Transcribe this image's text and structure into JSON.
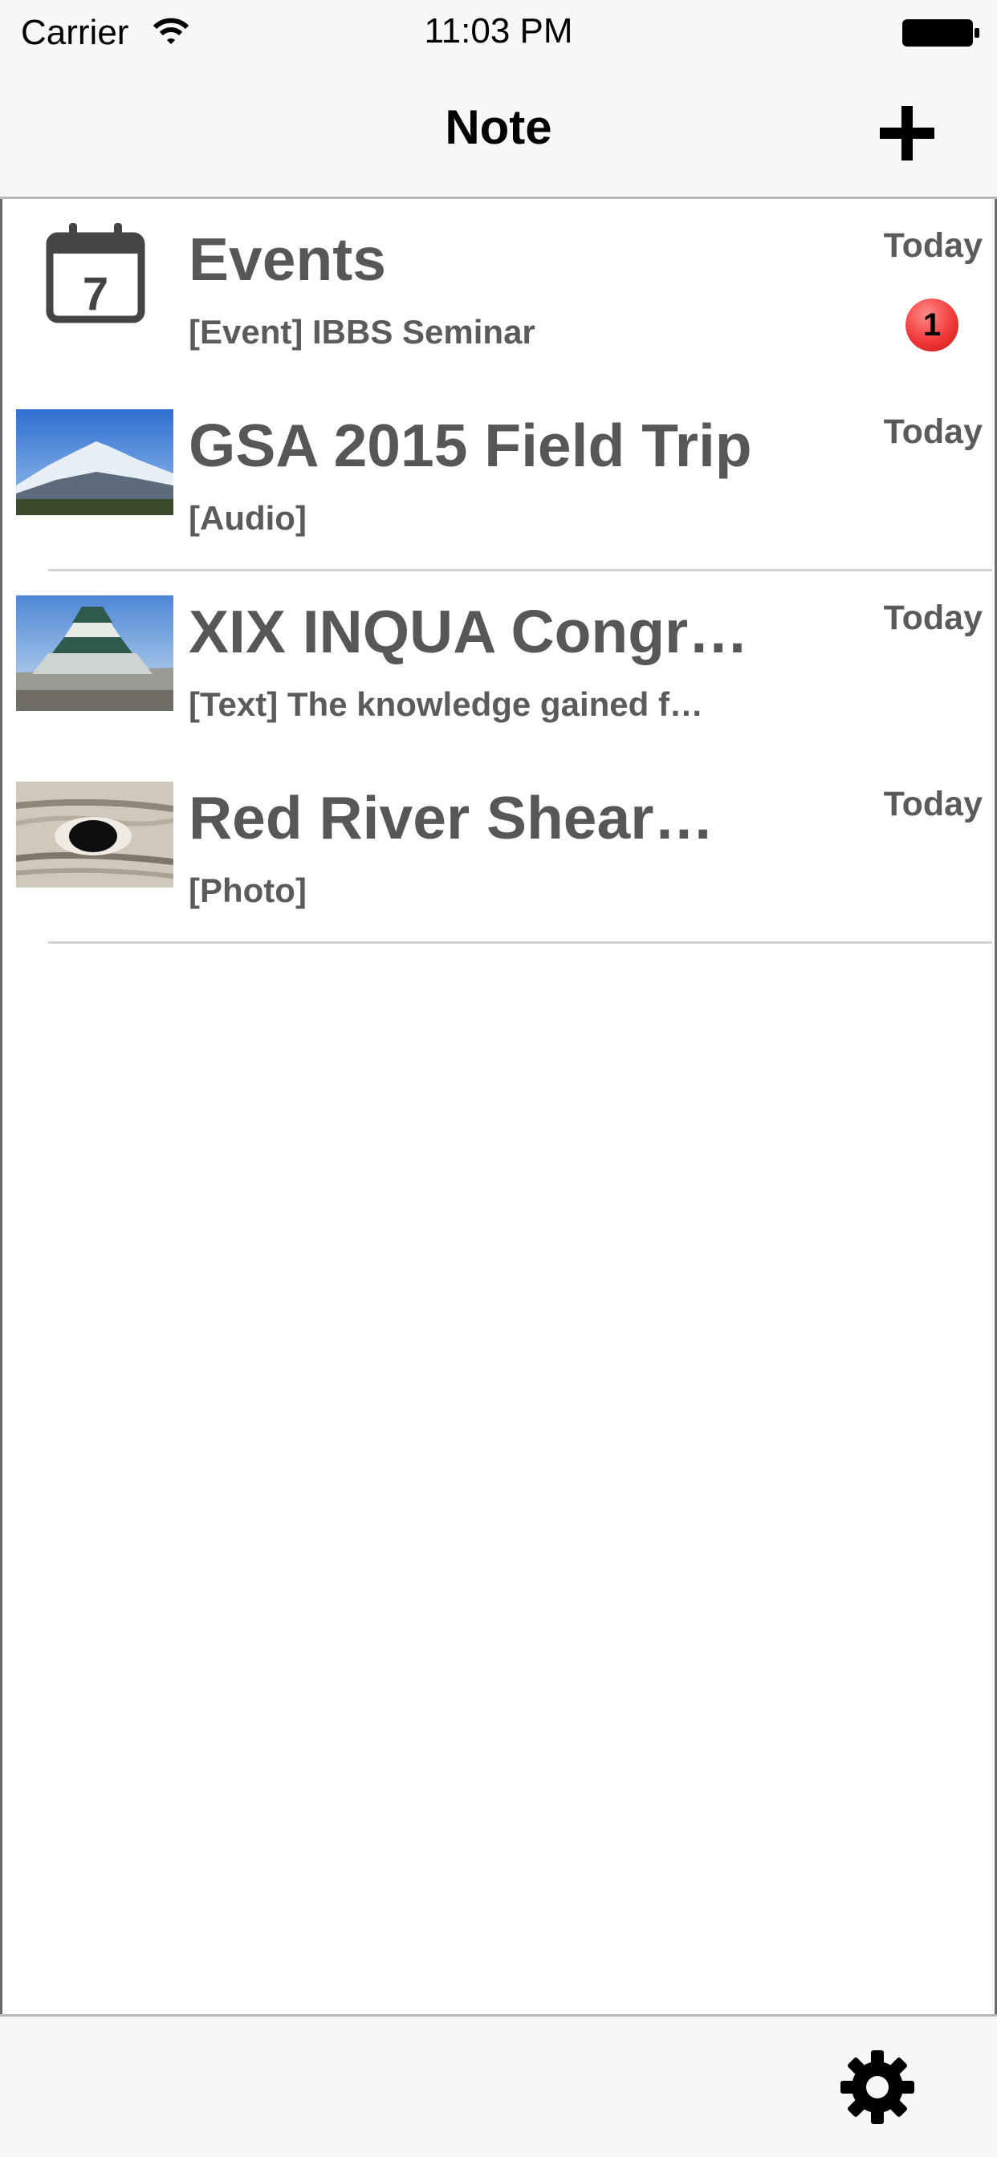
{
  "status_bar": {
    "carrier": "Carrier",
    "time": "11:03 PM"
  },
  "nav": {
    "title": "Note",
    "add_icon": "plus-icon"
  },
  "notes": [
    {
      "title": "Events",
      "subtitle": "[Event] IBBS Seminar",
      "date": "Today",
      "badge": "1",
      "icon": "calendar-icon",
      "icon_text": "7"
    },
    {
      "title": "GSA 2015 Field Trip",
      "subtitle": "[Audio]",
      "date": "Today",
      "icon": "mountain-thumbnail"
    },
    {
      "title": "XIX INQUA Congr…",
      "subtitle": "[Text] The knowledge gained f…",
      "date": "Today",
      "icon": "castle-thumbnail"
    },
    {
      "title": "Red River Shear…",
      "subtitle": "[Photo]",
      "date": "Today",
      "icon": "rock-thumbnail"
    }
  ],
  "toolbar": {
    "settings_icon": "gear-icon"
  },
  "colors": {
    "bar_bg": "#f7f7f7",
    "text_gray": "#575757",
    "badge_red": "#f23a3a"
  }
}
